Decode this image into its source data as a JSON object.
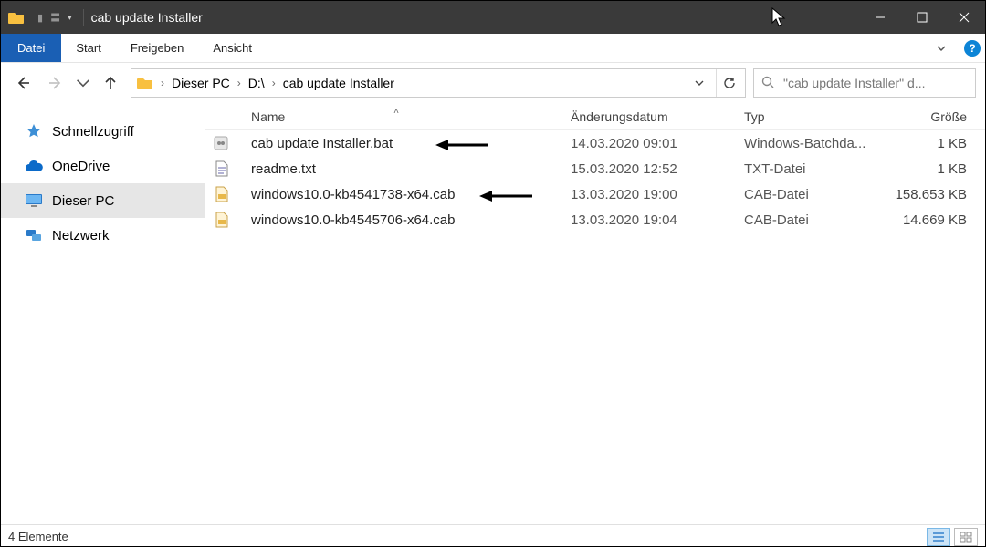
{
  "window": {
    "title": "cab update Installer"
  },
  "ribbon": {
    "file": "Datei",
    "tabs": [
      "Start",
      "Freigeben",
      "Ansicht"
    ]
  },
  "breadcrumb": {
    "items": [
      "Dieser PC",
      "D:\\",
      "cab update Installer"
    ]
  },
  "search": {
    "placeholder": "\"cab update Installer\" d..."
  },
  "sidebar": {
    "items": [
      {
        "label": "Schnellzugriff",
        "icon": "star"
      },
      {
        "label": "OneDrive",
        "icon": "cloud"
      },
      {
        "label": "Dieser PC",
        "icon": "monitor",
        "selected": true
      },
      {
        "label": "Netzwerk",
        "icon": "network"
      }
    ]
  },
  "columns": {
    "name": "Name",
    "date": "Änderungsdatum",
    "type": "Typ",
    "size": "Größe"
  },
  "files": [
    {
      "name": "cab update Installer.bat",
      "date": "14.03.2020 09:01",
      "type": "Windows-Batchda...",
      "size": "1 KB",
      "icon": "bat",
      "arrow": true
    },
    {
      "name": "readme.txt",
      "date": "15.03.2020 12:52",
      "type": "TXT-Datei",
      "size": "1 KB",
      "icon": "txt"
    },
    {
      "name": "windows10.0-kb4541738-x64.cab",
      "date": "13.03.2020 19:00",
      "type": "CAB-Datei",
      "size": "158.653 KB",
      "icon": "cab",
      "arrow": true
    },
    {
      "name": "windows10.0-kb4545706-x64.cab",
      "date": "13.03.2020 19:04",
      "type": "CAB-Datei",
      "size": "14.669 KB",
      "icon": "cab"
    }
  ],
  "status": {
    "count": "4 Elemente"
  }
}
